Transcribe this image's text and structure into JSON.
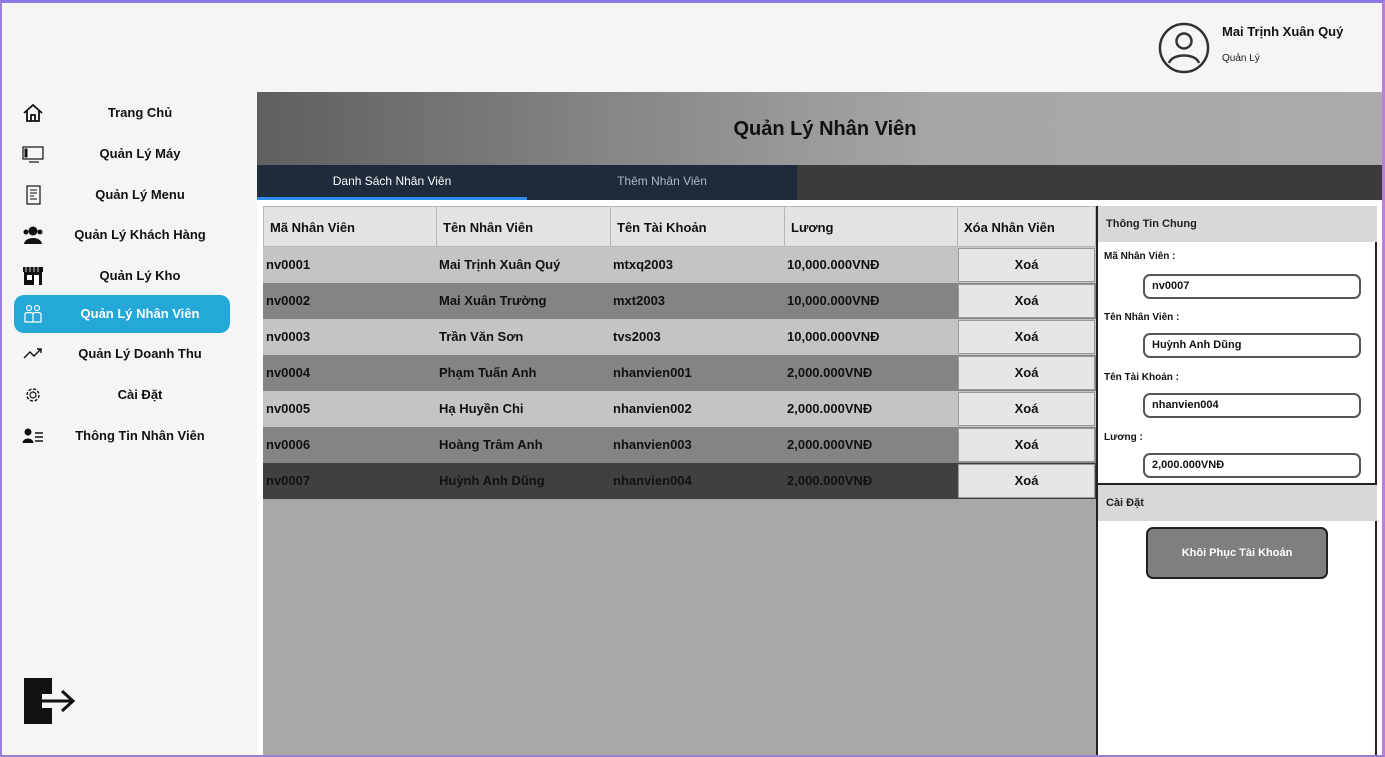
{
  "header": {
    "user_name": "Mai Trịnh Xuân Quý",
    "user_role": "Quản Lý",
    "avatar_icon": "user-circle-icon"
  },
  "sidebar": {
    "items": [
      {
        "label": "Trang Chủ",
        "icon": "home-icon"
      },
      {
        "label": "Quản Lý Máy",
        "icon": "computer-icon"
      },
      {
        "label": "Quản Lý Menu",
        "icon": "menu-list-icon"
      },
      {
        "label": "Quản Lý Khách Hàng",
        "icon": "customers-icon"
      },
      {
        "label": "Quản Lý Kho",
        "icon": "store-icon"
      },
      {
        "label": "Quản Lý Nhân Viên",
        "icon": "employees-icon",
        "active": true
      },
      {
        "label": "Quản Lý Doanh Thu",
        "icon": "trend-up-icon"
      },
      {
        "label": "Cài Đặt",
        "icon": "gear-icon"
      },
      {
        "label": "Thông Tin Nhân Viên",
        "icon": "user-info-icon"
      }
    ],
    "logout_icon": "logout-icon",
    "active_color": "#24a8d8"
  },
  "main": {
    "title": "Quản Lý Nhân Viên",
    "tabs": [
      {
        "label": "Danh Sách Nhân Viên",
        "active": true
      },
      {
        "label": "Thêm Nhân Viên",
        "active": false
      }
    ],
    "table": {
      "columns": [
        "Mã Nhân Viên",
        "Tên Nhân Viên",
        "Tên Tài Khoản",
        "Lương",
        "Xóa Nhân Viên"
      ],
      "rows": [
        {
          "id": "nv0001",
          "name": "Mai Trịnh Xuân Quý",
          "account": "mtxq2003",
          "salary": "10,000.000VNĐ",
          "action": "Xoá"
        },
        {
          "id": "nv0002",
          "name": "Mai Xuân Trường",
          "account": "mxt2003",
          "salary": "10,000.000VNĐ",
          "action": "Xoá"
        },
        {
          "id": "nv0003",
          "name": "Trần Văn Sơn",
          "account": "tvs2003",
          "salary": "10,000.000VNĐ",
          "action": "Xoá"
        },
        {
          "id": "nv0004",
          "name": "Phạm Tuấn Anh",
          "account": "nhanvien001",
          "salary": "2,000.000VNĐ",
          "action": "Xoá"
        },
        {
          "id": "nv0005",
          "name": "Hạ Huyền Chi",
          "account": "nhanvien002",
          "salary": "2,000.000VNĐ",
          "action": "Xoá"
        },
        {
          "id": "nv0006",
          "name": "Hoàng Trâm Anh",
          "account": "nhanvien003",
          "salary": "2,000.000VNĐ",
          "action": "Xoá"
        },
        {
          "id": "nv0007",
          "name": "Huỳnh Anh Dũng",
          "account": "nhanvien004",
          "salary": "2,000.000VNĐ",
          "action": "Xoá"
        }
      ]
    }
  },
  "panel": {
    "general_title": "Thông Tin Chung",
    "fields": [
      {
        "label": "Mã Nhân Viên :",
        "value": "nv0007"
      },
      {
        "label": "Tên Nhân Viên :",
        "value": "Huỳnh Anh Dũng"
      },
      {
        "label": "Tên Tài Khoản :",
        "value": "nhanvien004"
      },
      {
        "label": "Lương :",
        "value": "2,000.000VNĐ"
      }
    ],
    "settings_title": "Cài Đặt",
    "restore_button": "Khôi Phục Tài Khoản"
  }
}
